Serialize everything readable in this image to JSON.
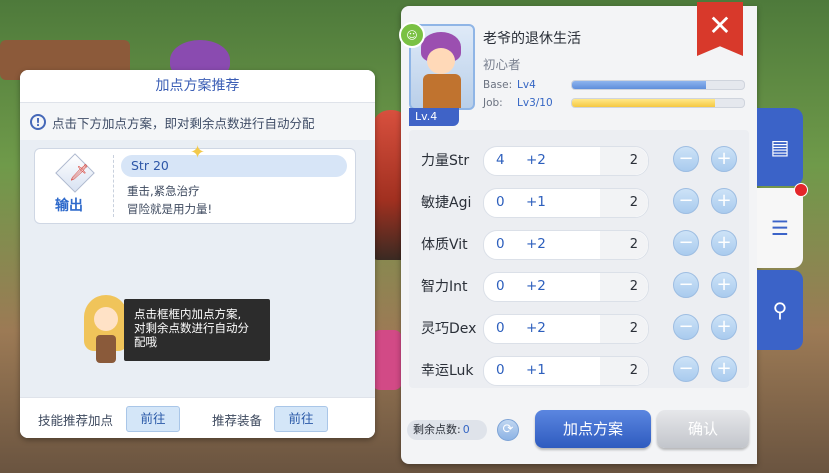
{
  "left_panel": {
    "title": "加点方案推荐",
    "hint": "点击下方加点方案，即对剩余点数进行自动分配",
    "plan": {
      "role": "输出",
      "stat": "Str 20",
      "desc_line1": "重击,紧急治疗",
      "desc_line2": "冒险就是用力量!"
    },
    "tooltip": {
      "line1": "点击框框内加点方案,",
      "line2": "对剩余点数进行自动分",
      "line3": "配哦"
    },
    "footer": {
      "skill_label": "技能推荐加点",
      "skill_button": "前往",
      "equip_label": "推荐装备",
      "equip_button": "前往"
    }
  },
  "character": {
    "name": "老爷的退休生活",
    "class": "初心者",
    "level_badge": "Lv.4",
    "base_label": "Base:",
    "base_level": "Lv4",
    "base_progress": 0.78,
    "job_label": "Job:",
    "job_level": "Lv3/10",
    "job_progress": 0.83
  },
  "stats": [
    {
      "name": "力量Str",
      "base": "4",
      "add": "+2",
      "cost": "2"
    },
    {
      "name": "敏捷Agi",
      "base": "0",
      "add": "+1",
      "cost": "2"
    },
    {
      "name": "体质Vit",
      "base": "0",
      "add": "+2",
      "cost": "2"
    },
    {
      "name": "智力Int",
      "base": "0",
      "add": "+2",
      "cost": "2"
    },
    {
      "name": "灵巧Dex",
      "base": "0",
      "add": "+2",
      "cost": "2"
    },
    {
      "name": "幸运Luk",
      "base": "0",
      "add": "+1",
      "cost": "2"
    }
  ],
  "bottom": {
    "remain_label": "剩余点数:",
    "remain_value": "0",
    "plan_button": "加点方案",
    "confirm_button": "确认"
  },
  "icons": {
    "close": "close-icon",
    "minus": "minus-icon",
    "plus": "plus-icon",
    "reset": "reset-icon",
    "tab1": "clipboard-icon",
    "tab2": "sliders-icon",
    "tab3": "hierarchy-icon"
  }
}
